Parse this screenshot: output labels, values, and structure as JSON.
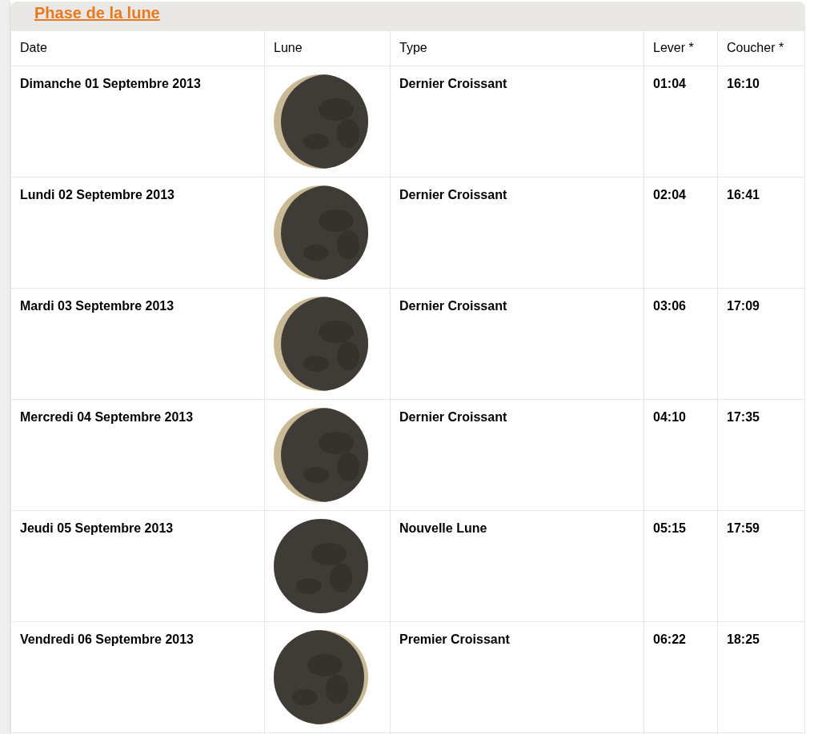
{
  "title": "Phase de la lune",
  "columns": [
    "Date",
    "Lune",
    "Type",
    "Lever *",
    "Coucher *"
  ],
  "rows": [
    {
      "kind": "waning",
      "date": "Dimanche 01 Septembre 2013",
      "type": "Dernier Croissant",
      "rise": "01:04",
      "set": "16:10"
    },
    {
      "kind": "waning",
      "date": "Lundi 02 Septembre 2013",
      "type": "Dernier Croissant",
      "rise": "02:04",
      "set": "16:41"
    },
    {
      "kind": "waning",
      "date": "Mardi 03 Septembre 2013",
      "type": "Dernier Croissant",
      "rise": "03:06",
      "set": "17:09"
    },
    {
      "kind": "waning",
      "date": "Mercredi 04 Septembre 2013",
      "type": "Dernier Croissant",
      "rise": "04:10",
      "set": "17:35"
    },
    {
      "kind": "new",
      "date": "Jeudi 05 Septembre 2013",
      "type": "Nouvelle Lune",
      "rise": "05:15",
      "set": "17:59"
    },
    {
      "kind": "waxing",
      "date": "Vendredi 06 Septembre 2013",
      "type": "Premier Croissant",
      "rise": "06:22",
      "set": "18:25"
    }
  ]
}
